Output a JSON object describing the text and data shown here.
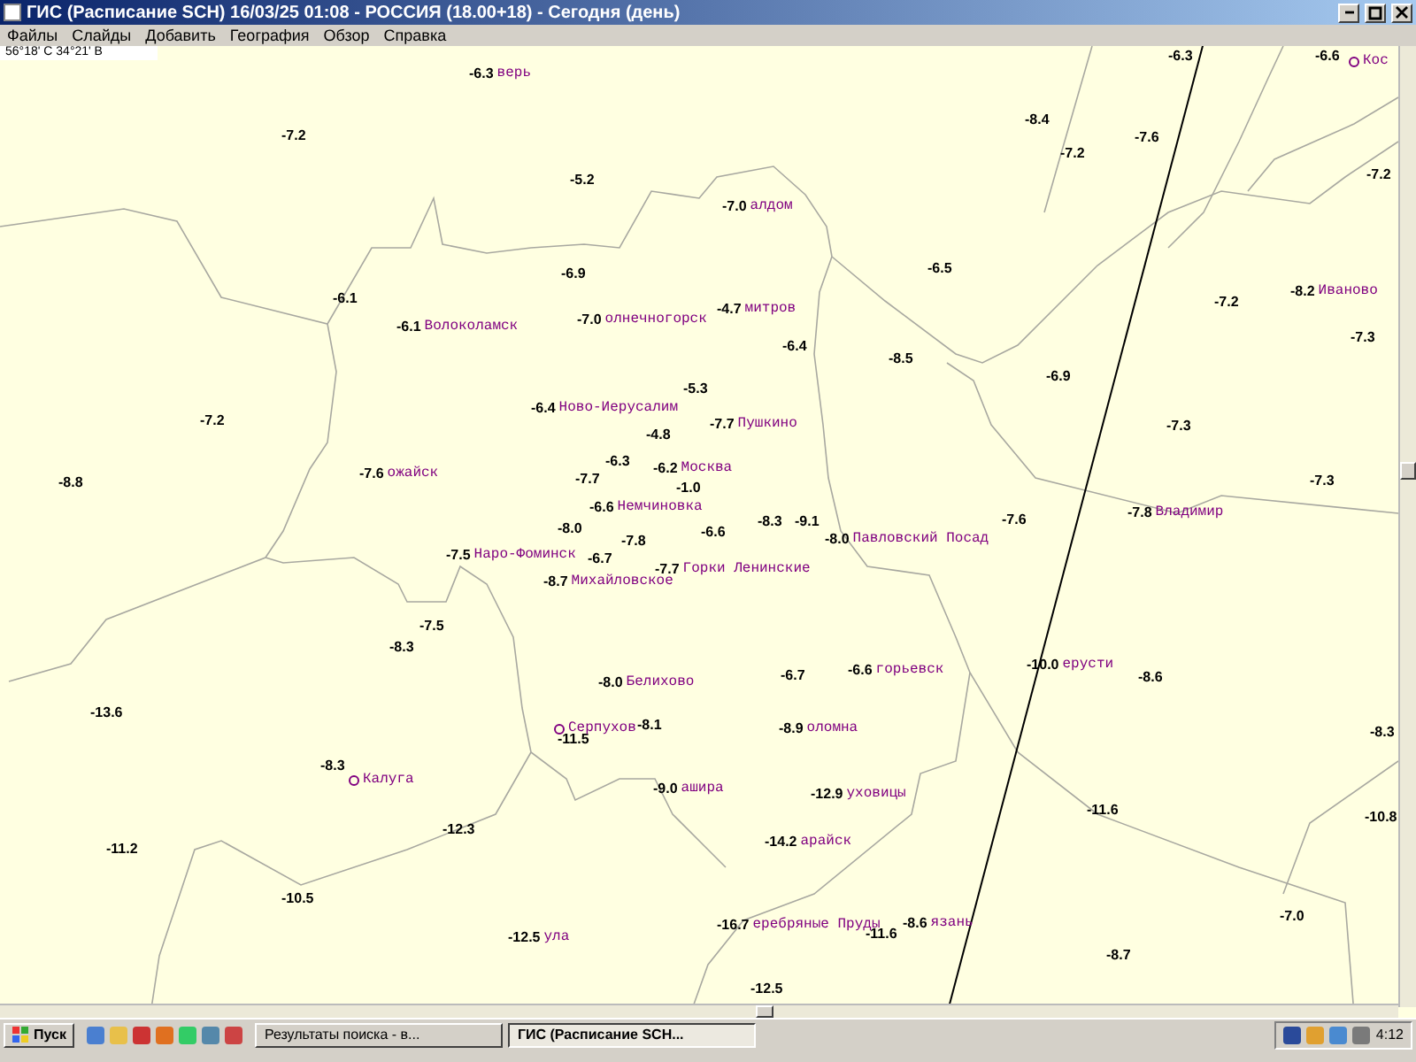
{
  "window": {
    "title": "ГИС (Расписание SCH) 16/03/25 01:08 - РОССИЯ (18.00+18) - Сегодня (день)"
  },
  "menu": [
    "Файлы",
    "Слайды",
    "Добавить",
    "География",
    "Обзор",
    "Справка"
  ],
  "coordinates": "56°18' С 34°21' В",
  "stations": [
    {
      "value": "-6.3",
      "city": "верь"
    },
    {
      "value": "-7.2"
    },
    {
      "value": "-5.2"
    },
    {
      "value": "-7.0",
      "city": "алдом"
    },
    {
      "value": "-6.9"
    },
    {
      "value": "-6.1"
    },
    {
      "value": "-6.1",
      "city": "Волоколамск"
    },
    {
      "value": "-7.0",
      "city": "олнечногорск"
    },
    {
      "value": "-4.7",
      "city": "митров"
    },
    {
      "value": "-6.4"
    },
    {
      "value": "-6.5"
    },
    {
      "value": "-8.4"
    },
    {
      "value": "-7.6"
    },
    {
      "value": "-7.2"
    },
    {
      "value": "-6.3"
    },
    {
      "value": "-6.6"
    },
    {
      "value": "-7.2"
    },
    {
      "value": "-8.5"
    },
    {
      "value": "-6.9"
    },
    {
      "value": "-7.2"
    },
    {
      "value": "-8.2",
      "city": "Иваново"
    },
    {
      "value": "-7.3"
    },
    {
      "value": "-7.3"
    },
    {
      "value": "-7.3"
    },
    {
      "value": "-7.8",
      "city": "Владимир"
    },
    {
      "value": "-7.2"
    },
    {
      "value": "-8.8"
    },
    {
      "value": "-7.6",
      "city": "ожайск"
    },
    {
      "value": "-5.3"
    },
    {
      "value": "-6.4",
      "city": "Ново-Иерусалим"
    },
    {
      "value": "-4.8"
    },
    {
      "value": "-7.7",
      "city": "Пушкино"
    },
    {
      "value": "-6.3"
    },
    {
      "value": "-6.2",
      "city": "Москва"
    },
    {
      "value": "-7.7"
    },
    {
      "value": "-1.0"
    },
    {
      "value": "-6.6",
      "city": "Немчиновка"
    },
    {
      "value": "-8.0"
    },
    {
      "value": "-7.8"
    },
    {
      "value": "-6.6"
    },
    {
      "value": "-8.3"
    },
    {
      "value": "-9.1"
    },
    {
      "value": "-8.0",
      "city": "Павловский Посад"
    },
    {
      "value": "-7.6"
    },
    {
      "value": "-7.5",
      "city": "Наро-Фоминск"
    },
    {
      "value": "-6.7"
    },
    {
      "value": "-8.7",
      "city": "Михайловское"
    },
    {
      "value": "-7.7",
      "city": "Горки Ленинские"
    },
    {
      "value": "-7.5"
    },
    {
      "value": "-8.3"
    },
    {
      "value": "-8.0",
      "city": "Белихово"
    },
    {
      "value": "-6.7"
    },
    {
      "value": "-6.6",
      "city": "горьевск"
    },
    {
      "value": "-10.0",
      "city": "ерусти"
    },
    {
      "value": "-8.6"
    },
    {
      "value": "-13.6"
    },
    {
      "value": "-11.5"
    },
    {
      "value": "-8.1"
    },
    {
      "value": "-8.9",
      "city": "оломна"
    },
    {
      "value": "-8.3"
    },
    {
      "value": "-9.0",
      "city": "ашира"
    },
    {
      "value": "-12.9",
      "city": "уховицы"
    },
    {
      "value": "-11.6"
    },
    {
      "value": "-12.3"
    },
    {
      "value": "-14.2",
      "city": "арайск"
    },
    {
      "value": "-11.2"
    },
    {
      "value": "-8.3"
    },
    {
      "value": "-10.8"
    },
    {
      "value": "-10.5"
    },
    {
      "value": "-12.5",
      "city": "ула"
    },
    {
      "value": "-16.7",
      "city": "еребряные Пруды"
    },
    {
      "value": "-11.6"
    },
    {
      "value": "-8.6",
      "city": "язань"
    },
    {
      "value": "-7.0"
    },
    {
      "value": "-8.7"
    },
    {
      "value": "-12.5"
    }
  ],
  "towns": [
    {
      "name": "Кос"
    },
    {
      "name": "Серпухов"
    },
    {
      "name": "Калуга"
    }
  ],
  "taskbar": {
    "start": "Пуск",
    "tasks": [
      {
        "label": "Результаты поиска - в...",
        "selected": false
      },
      {
        "label": "ГИС (Расписание SCH...",
        "selected": true
      }
    ],
    "clock": "4:12"
  }
}
